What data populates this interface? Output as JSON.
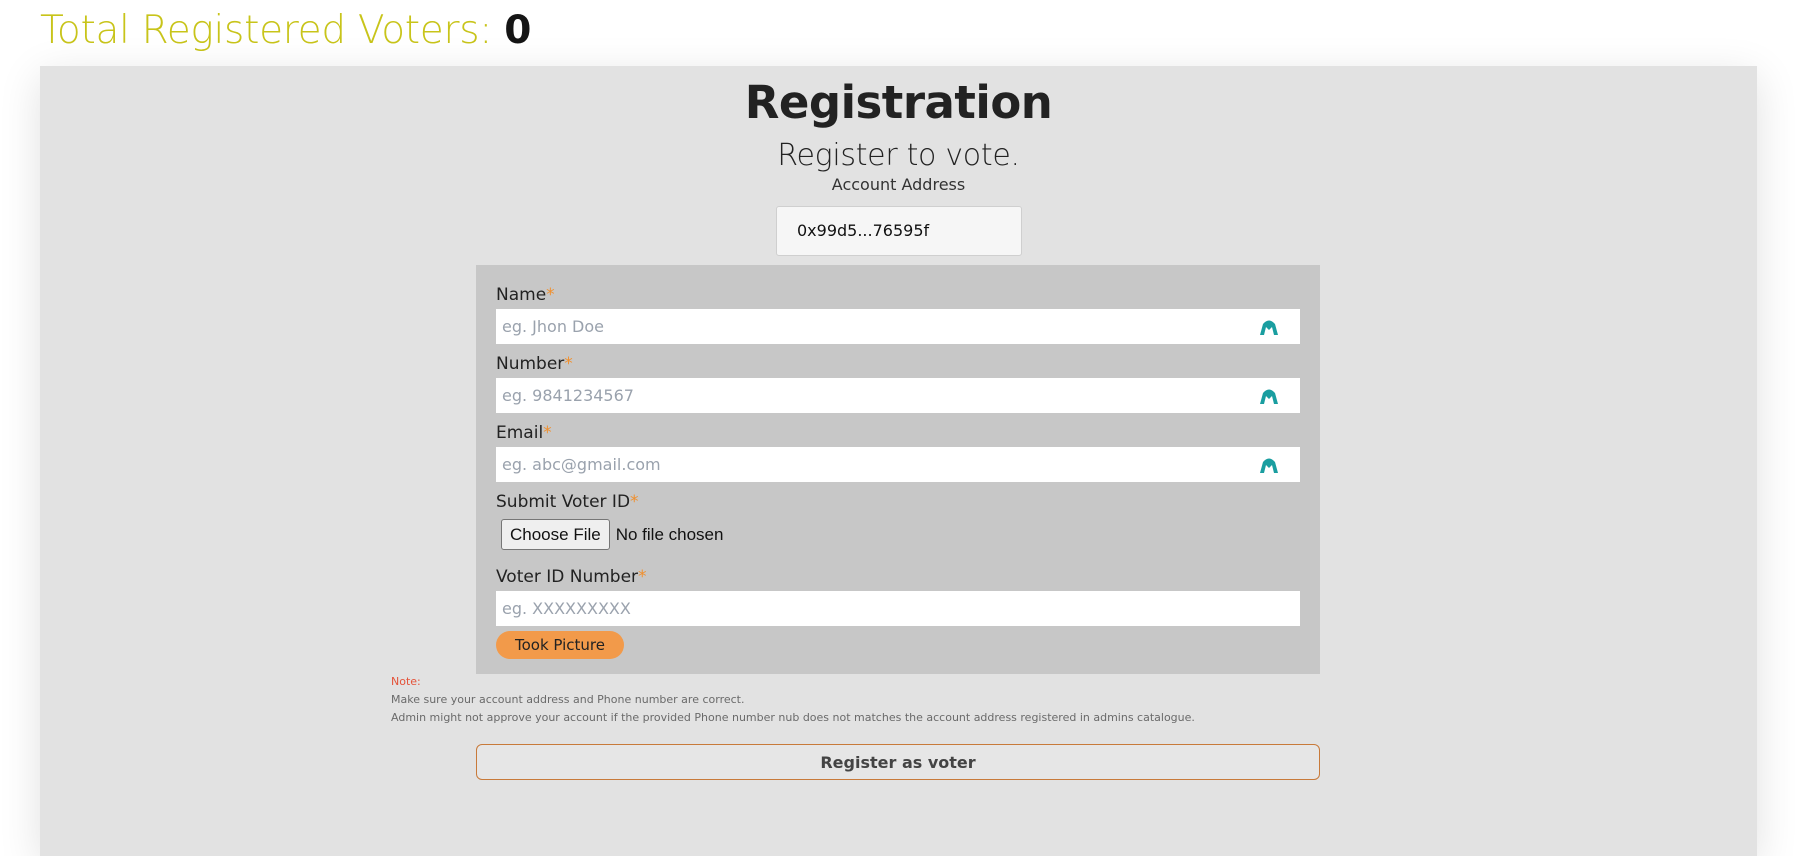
{
  "header": {
    "count_label": "Total Registered Voters: ",
    "count_value": "0"
  },
  "registration": {
    "title": "Registration",
    "subtitle": "Register to vote.",
    "account_label": "Account Address",
    "account_value": "0x99d5...76595f"
  },
  "form": {
    "name_label": "Name",
    "name_placeholder": "eg. Jhon Doe",
    "number_label": "Number",
    "number_placeholder": "eg. 9841234567",
    "email_label": "Email",
    "email_placeholder": "eg. abc@gmail.com",
    "voter_id_file_label": "Submit Voter ID",
    "choose_file_label": "Choose File",
    "file_status": "No file chosen",
    "voter_id_number_label": "Voter ID Number",
    "voter_id_number_placeholder": "eg. XXXXXXXXX",
    "required_mark": "*",
    "took_picture_label": "Took Picture"
  },
  "note": {
    "title": "Note:",
    "line1": "Make sure your account address and Phone number are correct.",
    "line2": "Admin might not approve your account if the provided Phone number nub does not matches the account address registered in admins catalogue."
  },
  "register_button_label": "Register as voter",
  "colors": {
    "accent_yellow": "#c8c41a",
    "accent_orange": "#f29a4a",
    "icon_teal": "#1a9ea0",
    "note_red": "#e4533a"
  },
  "icons": {
    "field_icon": "autofill-icon"
  }
}
